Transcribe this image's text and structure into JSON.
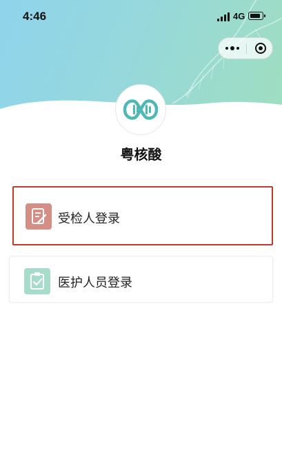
{
  "status_bar": {
    "time": "4:46",
    "network": "4G"
  },
  "app": {
    "title": "粤核酸"
  },
  "login_options": [
    {
      "label": "受检人登录",
      "icon": "edit-document-icon",
      "icon_color": "#d58e86"
    },
    {
      "label": "医护人员登录",
      "icon": "clipboard-check-icon",
      "icon_color": "#a7dccb"
    }
  ],
  "colors": {
    "highlight_border": "#c0392b",
    "header_gradient_start": "#8fd4ec",
    "header_gradient_end": "#9fdec0"
  }
}
